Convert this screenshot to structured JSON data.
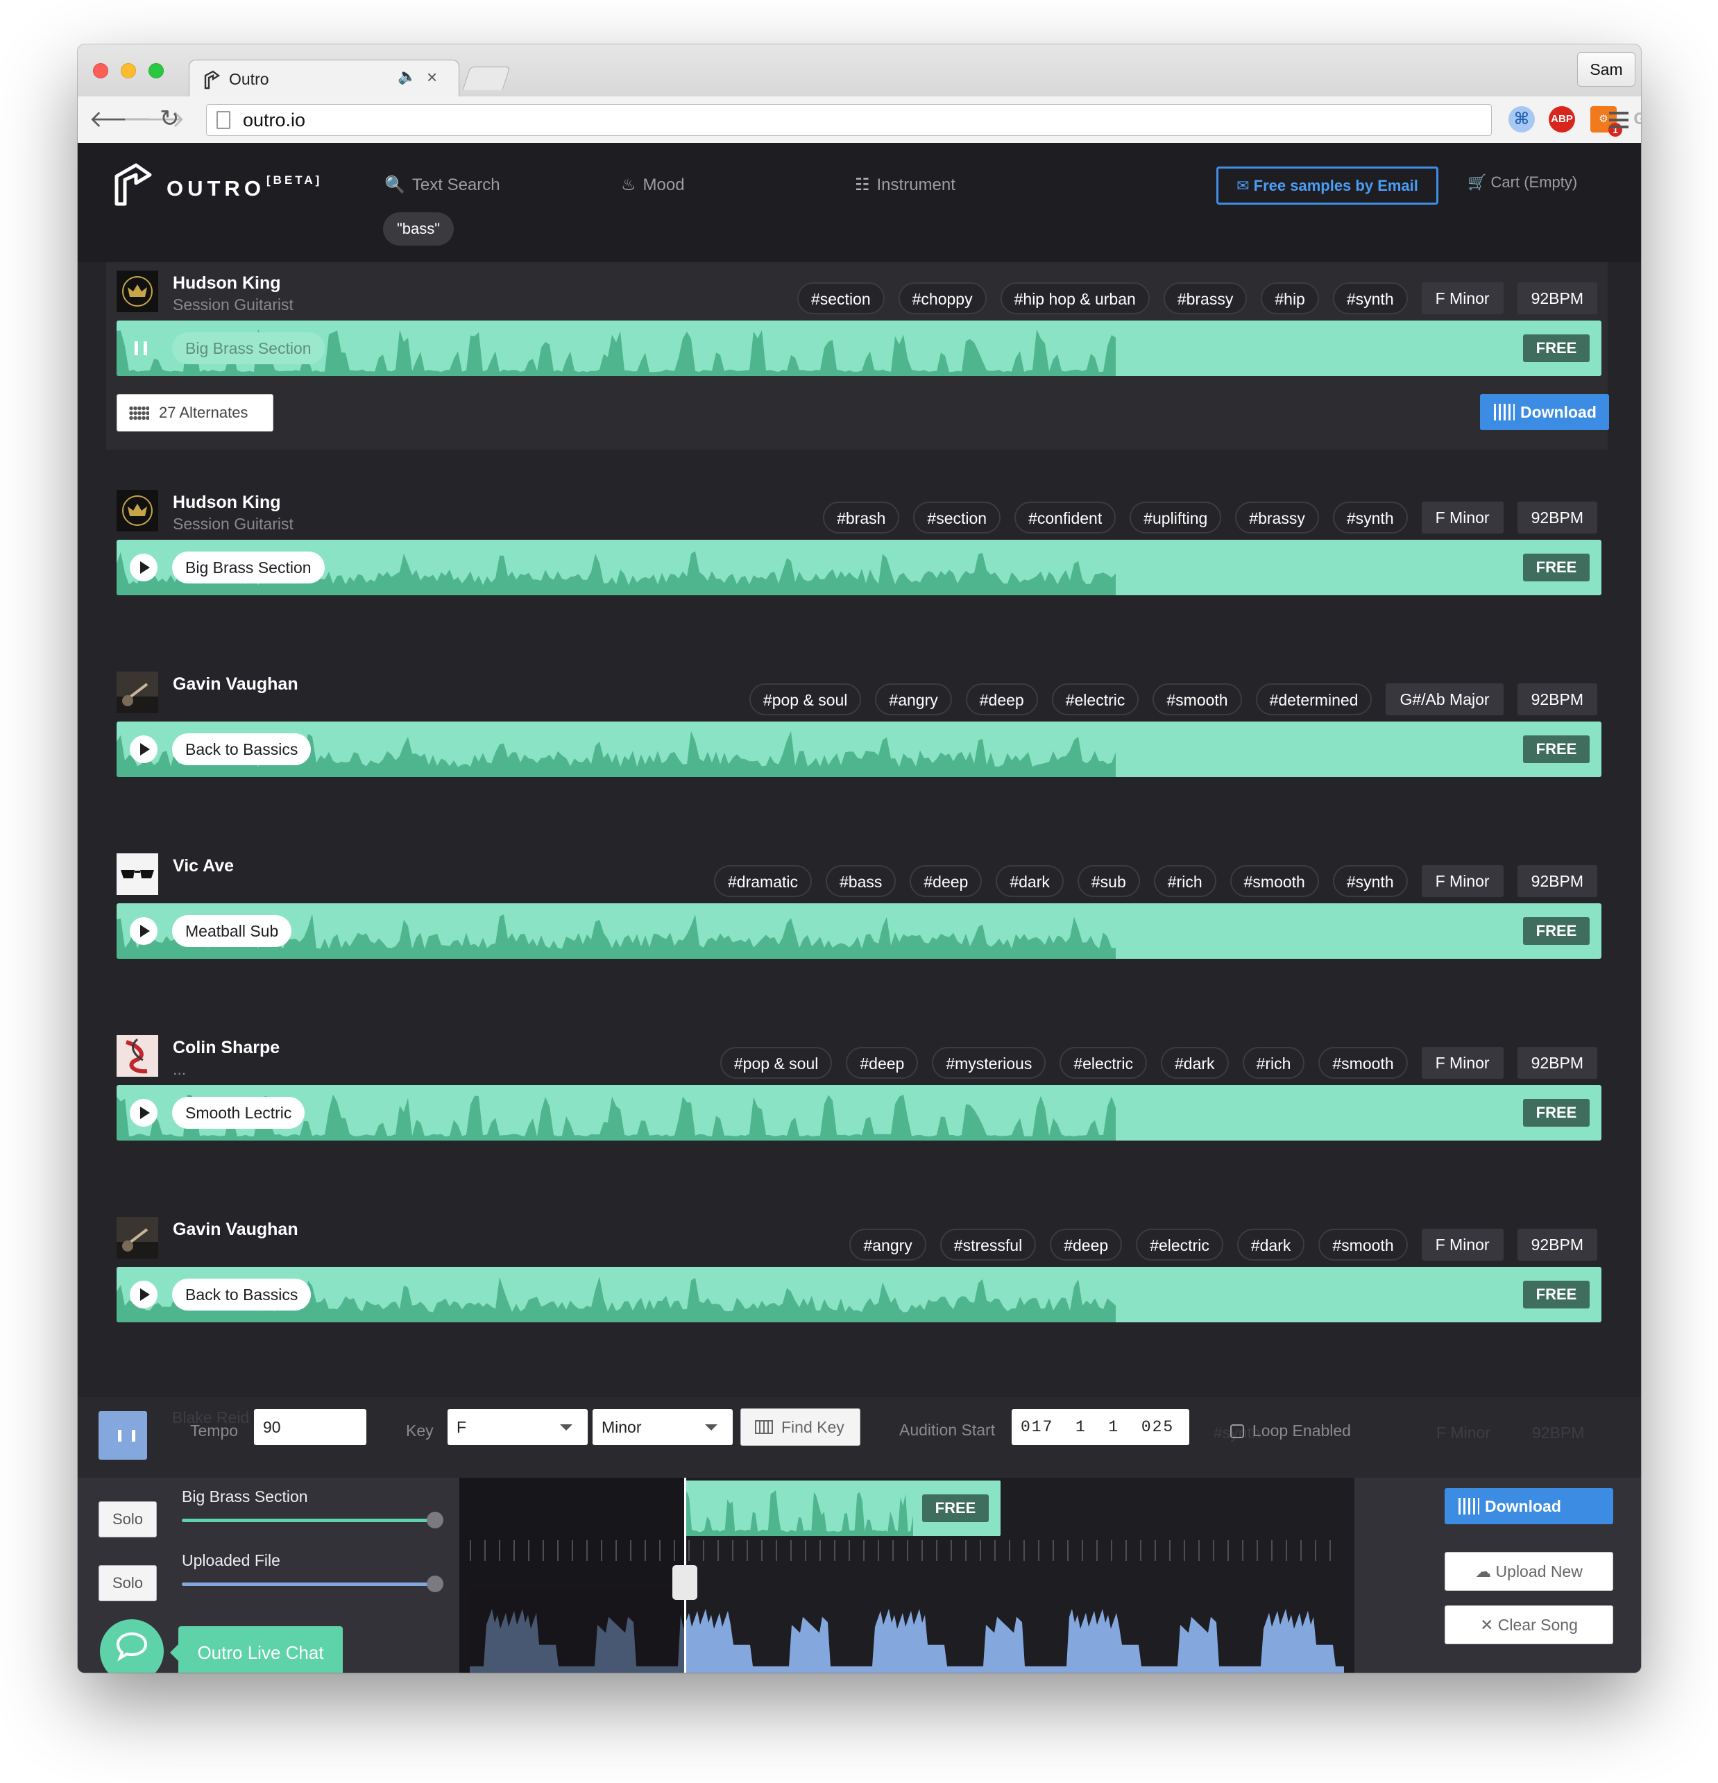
{
  "browser": {
    "tab_title": "Outro",
    "url": "outro.io",
    "user": "Sam",
    "extensions": [
      "shortcut-icon",
      "adblock-icon",
      "hubspot-icon",
      "gl-icon"
    ],
    "ext_abp": "ABP",
    "ext_gl": "GL",
    "ext_badge": "1"
  },
  "header": {
    "brand": "OUTRO",
    "beta": "[BETA]",
    "nav": [
      {
        "label": "Text Search",
        "icon": "search-icon"
      },
      {
        "label": "Mood",
        "icon": "flame-icon"
      },
      {
        "label": "Instrument",
        "icon": "piano-icon"
      }
    ],
    "query_pill": "\"bass\"",
    "email_button": "Free samples by Email",
    "cart": "Cart (Empty)"
  },
  "results": [
    {
      "artist": "Hudson King",
      "role": "Session Guitarist",
      "avatar": "crown",
      "tags": [
        "#section",
        "#choppy",
        "#hip hop & urban",
        "#brassy",
        "#hip",
        "#synth"
      ],
      "key": "F Minor",
      "bpm": "92BPM",
      "title": "Big Brass Section",
      "price": "FREE",
      "playing": true,
      "alternates": "27 Alternates",
      "download": "Download"
    },
    {
      "artist": "Hudson King",
      "role": "Session Guitarist",
      "avatar": "crown",
      "tags": [
        "#brash",
        "#section",
        "#confident",
        "#uplifting",
        "#brassy",
        "#synth"
      ],
      "key": "F Minor",
      "bpm": "92BPM",
      "title": "Big Brass Section",
      "price": "FREE",
      "playing": false
    },
    {
      "artist": "Gavin Vaughan",
      "role": "",
      "avatar": "guitar",
      "tags": [
        "#pop & soul",
        "#angry",
        "#deep",
        "#electric",
        "#smooth",
        "#determined"
      ],
      "key": "G#/Ab Major",
      "bpm": "92BPM",
      "title": "Back to Bassics",
      "price": "FREE",
      "playing": false
    },
    {
      "artist": "Vic Ave",
      "role": "",
      "avatar": "sunglasses",
      "tags": [
        "#dramatic",
        "#bass",
        "#deep",
        "#dark",
        "#sub",
        "#rich",
        "#smooth",
        "#synth"
      ],
      "key": "F Minor",
      "bpm": "92BPM",
      "title": "Meatball Sub",
      "price": "FREE",
      "playing": false
    },
    {
      "artist": "Colin Sharpe",
      "role": "...",
      "avatar": "art",
      "tags": [
        "#pop & soul",
        "#deep",
        "#mysterious",
        "#electric",
        "#dark",
        "#rich",
        "#smooth"
      ],
      "key": "F Minor",
      "bpm": "92BPM",
      "title": "Smooth Lectric",
      "price": "FREE",
      "playing": false
    },
    {
      "artist": "Gavin Vaughan",
      "role": "",
      "avatar": "guitar",
      "tags": [
        "#angry",
        "#stressful",
        "#deep",
        "#electric",
        "#dark",
        "#smooth"
      ],
      "key": "F Minor",
      "bpm": "92BPM",
      "title": "Back to Bassics",
      "price": "FREE",
      "playing": false
    }
  ],
  "player": {
    "ghost_artist": "Blake Reid",
    "ghost_tag": "#synth",
    "ghost_key": "F Minor",
    "ghost_bpm": "92BPM",
    "tempo_label": "Tempo",
    "tempo_value": "90",
    "key_label": "Key",
    "key_value": "F",
    "mode_value": "Minor",
    "find_key": "Find Key",
    "audition_label": "Audition Start",
    "audition_value": "017  1  1  025",
    "loop_label": "Loop Enabled",
    "tracks": [
      {
        "solo": "Solo",
        "name": "Big Brass Section",
        "level": 1.0
      },
      {
        "solo": "Solo",
        "name": "Uploaded File",
        "level": 1.0
      }
    ],
    "clip_price": "FREE",
    "download": "Download",
    "upload_new": "Upload New",
    "clear_song": "Clear Song"
  },
  "chat": {
    "label": "Outro Live Chat"
  },
  "colors": {
    "accent_green": "#8be3c6",
    "dark_green": "#3f6e5e",
    "blue": "#3d8ce3",
    "bg": "#252428"
  }
}
